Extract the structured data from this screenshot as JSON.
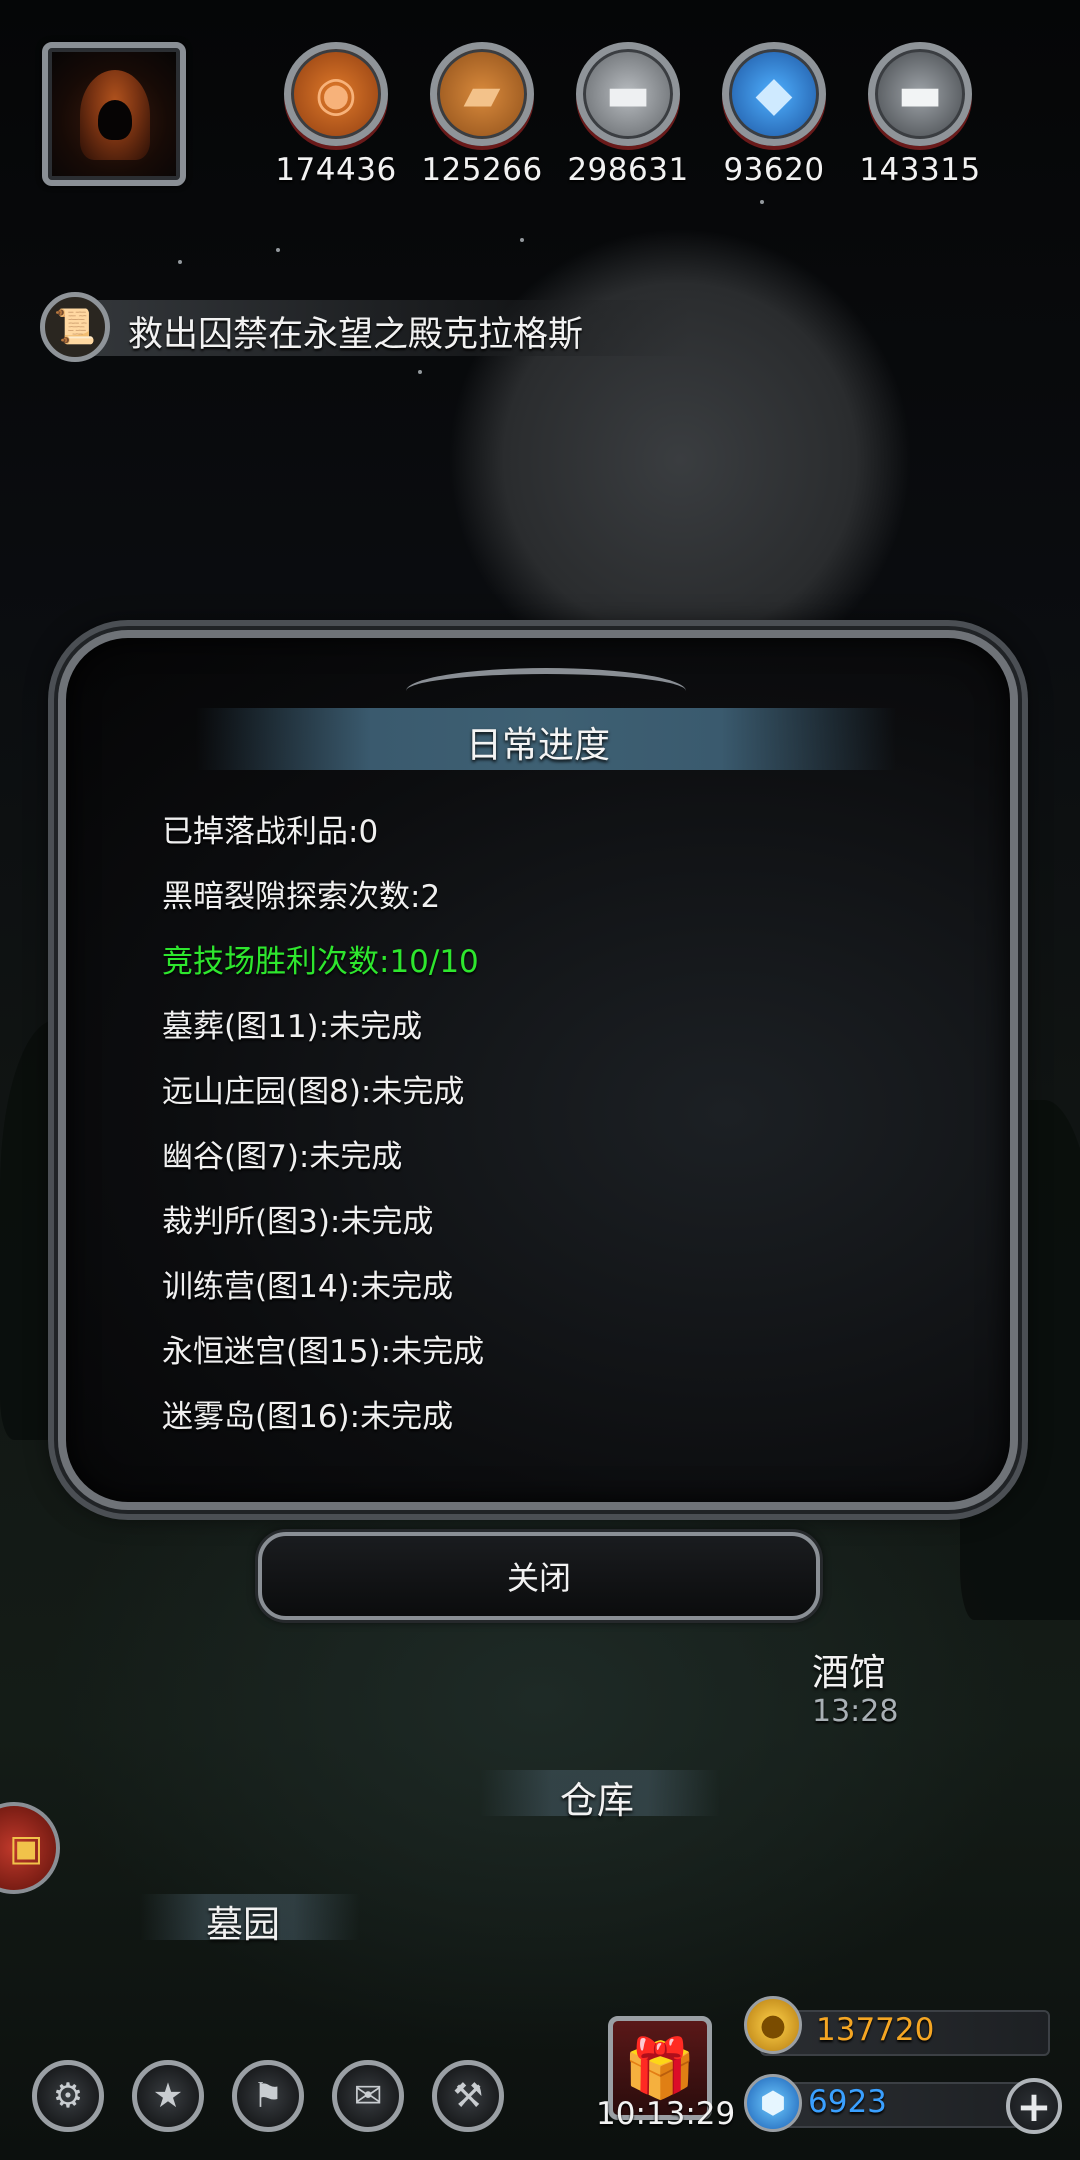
{
  "resources": [
    {
      "icon": "ore-icon",
      "value": "174436"
    },
    {
      "icon": "wood-plank-icon",
      "value": "125266"
    },
    {
      "icon": "iron-ingot-icon",
      "value": "298631"
    },
    {
      "icon": "crystal-icon",
      "value": "93620"
    },
    {
      "icon": "steel-ingot-icon",
      "value": "143315"
    }
  ],
  "quest": {
    "icon": "scroll-icon",
    "text": "救出囚禁在永望之殿克拉格斯"
  },
  "dialog": {
    "title": "日常进度",
    "items": [
      {
        "text": "已掉落战利品:0",
        "done": false
      },
      {
        "text": "黑暗裂隙探索次数:2",
        "done": false
      },
      {
        "text": "竞技场胜利次数:10/10",
        "done": true
      },
      {
        "text": "墓葬(图11):未完成",
        "done": false
      },
      {
        "text": "远山庄园(图8):未完成",
        "done": false
      },
      {
        "text": "幽谷(图7):未完成",
        "done": false
      },
      {
        "text": "裁判所(图3):未完成",
        "done": false
      },
      {
        "text": "训练营(图14):未完成",
        "done": false
      },
      {
        "text": "永恒迷宫(图15):未完成",
        "done": false
      },
      {
        "text": "迷雾岛(图16):未完成",
        "done": false
      }
    ],
    "close_label": "关闭"
  },
  "scene": {
    "tavern": {
      "label": "酒馆",
      "timer": "13:28"
    },
    "warehouse": {
      "label": "仓库"
    },
    "graveyard": {
      "label": "墓园"
    }
  },
  "bottom_menu": [
    {
      "name": "settings-button",
      "icon": "gear-icon",
      "glyph": "⚙"
    },
    {
      "name": "achievements-button",
      "icon": "star-icon",
      "glyph": "★"
    },
    {
      "name": "guild-button",
      "icon": "banner-icon",
      "glyph": "⚑"
    },
    {
      "name": "mail-button",
      "icon": "envelope-icon",
      "glyph": "✉"
    },
    {
      "name": "trade-button",
      "icon": "handshake-icon",
      "glyph": "⚒"
    }
  ],
  "gift": {
    "icon": "gift-box-icon",
    "timer": "10:13:29"
  },
  "currency": {
    "gold": {
      "icon": "gold-coins-icon",
      "value": "137720",
      "color": "#f5a623"
    },
    "gems": {
      "icon": "gem-icon",
      "value": "6923",
      "color": "#3aa0ff"
    }
  }
}
